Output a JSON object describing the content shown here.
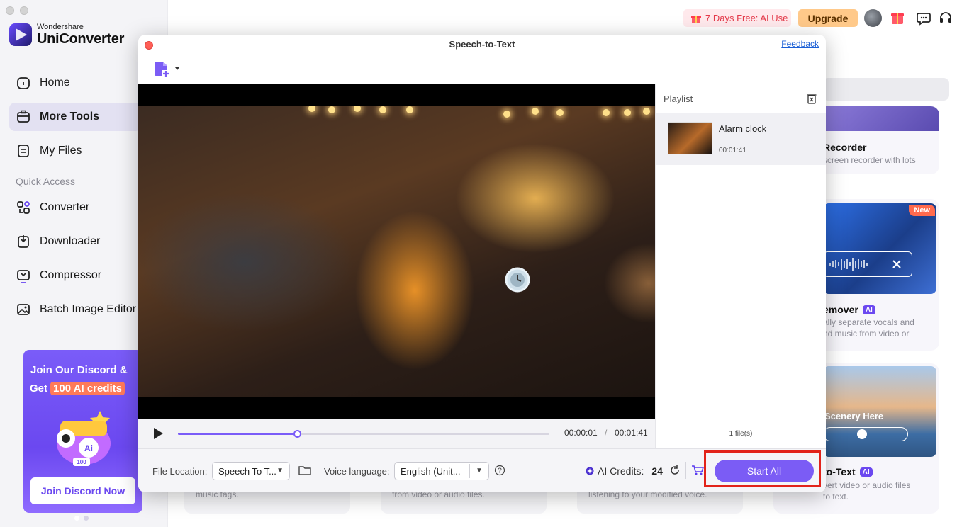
{
  "app": {
    "brand_small": "Wondershare",
    "brand_name": "UniConverter"
  },
  "sidebar": {
    "items": [
      {
        "label": "Home",
        "icon": "home-icon"
      },
      {
        "label": "More Tools",
        "icon": "toolbox-icon",
        "active": true
      },
      {
        "label": "My Files",
        "icon": "file-icon"
      }
    ],
    "quick_access_label": "Quick Access",
    "quick_access": [
      {
        "label": "Converter",
        "icon": "converter-icon"
      },
      {
        "label": "Downloader",
        "icon": "download-icon"
      },
      {
        "label": "Compressor",
        "icon": "compress-icon"
      },
      {
        "label": "Batch Image Editor",
        "icon": "image-edit-icon"
      }
    ],
    "promo": {
      "line1": "Join Our Discord &",
      "line2_prefix": "Get",
      "line2_highlight": "100 AI credits",
      "badge": "100",
      "button": "Join Discord Now"
    }
  },
  "topbar": {
    "trial_label": "7 Days Free: AI Use",
    "upgrade_label": "Upgrade"
  },
  "background_cards": {
    "card1": {
      "title": "Recorder",
      "desc_line1": "screen recorder with lots"
    },
    "card2": {
      "badge": "New",
      "title": "emover",
      "desc_line1": "ally separate vocals and",
      "desc_line2": "nd music from video or"
    },
    "card3": {
      "overlay": "Scenery Here",
      "title": "to-Text",
      "desc_line1": "vert video or audio files",
      "desc_line2": "to text."
    },
    "bottom": [
      "music tags.",
      "from video or audio files.",
      "listening to your modified voice."
    ]
  },
  "dialog": {
    "title": "Speech-to-Text",
    "feedback": "Feedback",
    "playback": {
      "current_time": "00:00:01",
      "separator": "/",
      "total_time": "00:01:41",
      "progress_fraction": 0.32
    },
    "playlist": {
      "header": "Playlist",
      "items": [
        {
          "name": "Alarm clock",
          "duration": "00:01:41"
        }
      ],
      "count_label": "1 file(s)"
    },
    "footer": {
      "file_location_label": "File Location:",
      "file_location_value": "Speech To T...",
      "voice_language_label": "Voice language:",
      "voice_language_value": "English (Unit...",
      "ai_credits_label": "AI Credits:",
      "ai_credits_value": "24",
      "start_all": "Start All"
    }
  },
  "colors": {
    "accent": "#7b5cf5",
    "highlight_box": "#e2231a",
    "trial_text": "#e43a4a",
    "upgrade_bg": "#ffc98a"
  }
}
